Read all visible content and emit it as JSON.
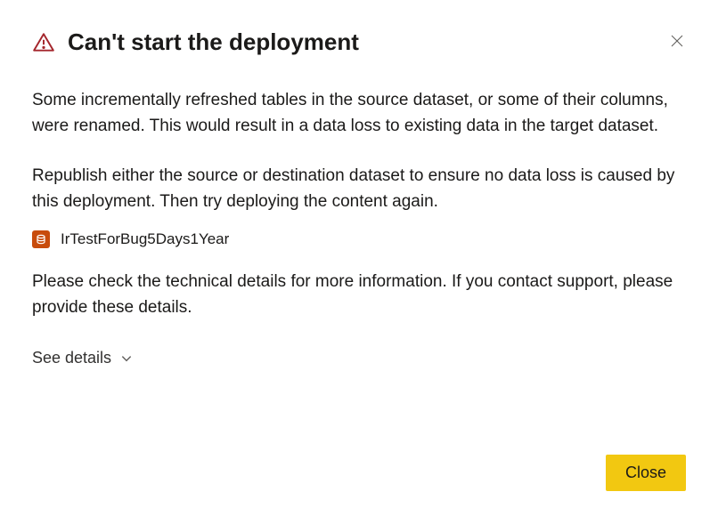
{
  "dialog": {
    "title": "Can't start the deployment",
    "paragraph1": "Some incrementally refreshed tables in the source dataset, or some of their columns, were renamed. This would result in a data loss to existing data in the target dataset.",
    "paragraph2": "Republish either the source or destination dataset to ensure no data loss is caused by this deployment. Then try deploying the content again.",
    "dataset_name": "IrTestForBug5Days1Year",
    "paragraph3": "Please check the technical details for more information. If you contact support, please provide these details.",
    "see_details_label": "See details",
    "close_button_label": "Close"
  },
  "colors": {
    "warning_red": "#a4262c",
    "dataset_icon_bg": "#c84c0c",
    "primary_button_bg": "#f2c811"
  }
}
